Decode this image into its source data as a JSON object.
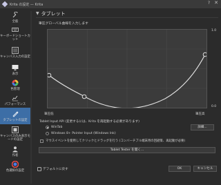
{
  "window": {
    "title": "Krita の設定 — Krita",
    "help_label": "?",
    "close_label": "✕"
  },
  "sidebar": {
    "items": [
      {
        "label": "全般",
        "icon": "wrench-icon"
      },
      {
        "label": "キーボードショートカット",
        "icon": "keyboard-icon"
      },
      {
        "label": "キャンバス入力の設定",
        "icon": "list-icon"
      },
      {
        "label": "表示",
        "icon": "monitor-icon"
      },
      {
        "label": "色管理",
        "icon": "color-wheel-icon"
      },
      {
        "label": "パフォーマンス",
        "icon": "performance-icon"
      },
      {
        "label": "タブレットの設定",
        "icon": "pen-icon"
      },
      {
        "label": "キャンバスのみ表示モードの設定",
        "icon": "canvas-icon"
      },
      {
        "label": "作者",
        "icon": "user-icon"
      },
      {
        "label": "色選択の設定",
        "icon": "color-selector-icon"
      }
    ],
    "active_index": 6
  },
  "panel": {
    "title": "タブレット",
    "pressure_label": "筆圧グローバル曲線を入力します",
    "curve": {
      "y_top": "1.0",
      "y_bottom": "0.0",
      "x_left": "筆圧低",
      "x_right": "筆圧高"
    },
    "api_label": "Tablet Input API (変更するには、Krita を再起動する必要があります)",
    "radio_wintab": "WinTab",
    "radio_pointer": "Windows 8+ Pointer Input (Windows Ink)",
    "detail_button": "詳細...",
    "mouse_check_label": "マウスイベントを使用してクリックとドラッグを行う (コンバーチブル端末用の回避策、再起動が必要)",
    "tester_button": "Tablet Tester を開く..."
  },
  "footer": {
    "reset_label": "デフォルトに戻す",
    "ok_label": "OK",
    "cancel_label": "キャンセル"
  },
  "colors": {
    "active": "#3d6ea6",
    "background": "#2b2b2b",
    "curve_bg": "#3b3b3b"
  }
}
